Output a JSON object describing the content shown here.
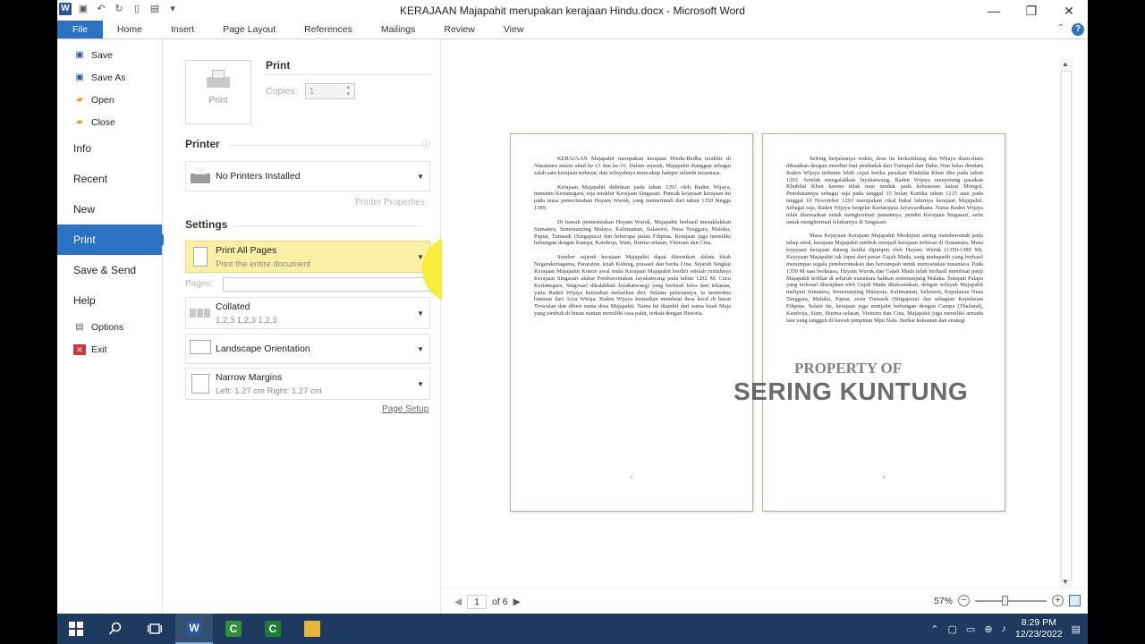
{
  "window": {
    "title": "KERAJAAN Majapahit merupakan kerajaan Hindu.docx - Microsoft Word",
    "minimize": "—",
    "maximize": "❐",
    "close": "✕"
  },
  "ribbon": {
    "tabs": [
      "File",
      "Home",
      "Insert",
      "Page Layout",
      "References",
      "Mailings",
      "Review",
      "View"
    ]
  },
  "backstage": {
    "small_top": [
      "Save",
      "Save As",
      "Open",
      "Close"
    ],
    "items": [
      "Info",
      "Recent",
      "New",
      "Print",
      "Save & Send",
      "Help"
    ],
    "small_bottom": [
      "Options",
      "Exit"
    ],
    "active": "Print"
  },
  "print_panel": {
    "heading": "Print",
    "print_button": "Print",
    "copies_label": "Copies:",
    "copies_value": "1",
    "printer_heading": "Printer",
    "printer_value": "No Printers Installed",
    "printer_properties": "Printer Properties",
    "settings_heading": "Settings",
    "print_range_title": "Print All Pages",
    "print_range_sub": "Print the entire document",
    "pages_label": "Pages:",
    "pages_value": "",
    "collated_title": "Collated",
    "collated_sub": "1,2,3    1,2,3    1,2,3",
    "orientation": "Landscape Orientation",
    "margins_title": "Narrow Margins",
    "margins_sub": "Left:  1.27 cm     Right:  1.27 cm",
    "page_setup": "Page Setup"
  },
  "preview": {
    "page1": [
      "KERAJAAN Majapahit merupakan kerajaan Hindu-Budha terakhir di Nusantara antara abad ke-13 dan ke-16. Dalam sejarah, Majapahit dianggap sebagai salah satu kerajaan terbesar, dan wilayahnya mencakup hampir seluruh nusantara.",
      "Kerajaan Majapahit didirikan pada tahun 1293 oleh Raden Wijaya, menantu Kertanegara, raja terakhir Kerajaan Singasari. Puncak kejayaan kerajaan itu pada masa pemerintahan Hayam Wuruk, yang memerintah dari tahun 1350 hingga 1389.",
      "Di bawah pemerintahan Hayam Wuruk, Majapahit berhasil menaklukkan Sumatera, Semenanjung Malaya, Kalimantan, Sulawesi, Nusa Tenggara, Maluku, Papua, Tumasik (Singapura) dan beberapa pulau Filipina. Kerajaan juga memiliki hubungan dengan Kampa, Kamboja, Siam, Burma selatan, Vietnam dan Cina.",
      "Sumber sejarah kerajaan Majapahit dapat ditemukan dalam kitab Negarakertagama, Pararaton, kitab Kidung, prasasti dan berita Cina. Sejarah Singkat Kerajaan Majapahit Konon awal mula Kerajaan Majapahit berdiri setelah runtuhnya Kerajaan Singasari akibat Pemberontakan Jayakatwang pada tahun 1292 M. Cucu Kertanegara, Singosari dikalahkan Jayakatwang) yang berhasil lolos dari tekanan, yaitu Raden Wijaya kemudian melarikan diri. Selama pelariannya, ia menerima bantuan dari Arya Wiraja. Raden Wijaya kemudian membuat desa kecil di hutan Trowulan dan diberi nama desa Majapahit. Nama ini diambil dari nama buah Maja yang tumbuh di hutan namun memiliki rasa pahit, terkait dengan Historia."
    ],
    "page2": [
      "Seiring berjalannya waktu, desa itu berkembang dan Wijaya diam-diam dikuatkan dengan merebut hati penduduk dari Tumapel dan Daha. Niat balas dendam Raden Wijaya terbantu lebih cepat ketika pasukan Khubilai Khan tiba pada tahun 1293. Setelah mengalahkan Jayakatwang, Raden Wijaya menyerang pasukan Khubilai Khan karena tidak mau tunduk pada kekuasaan kaisar Mongol. Penobatannya sebagai raja pada tanggal 15 bulan Kartika tahun 1215 atau pada tanggal 10 November 1293 merupakan cikal bakal lahirnya kerajaan Majapahit. Sebagai raja, Raden Wijaya bergelar Kertarajasa Jayawardhana. Nama Raden Wijaya telah disematkan untuk menghormati pamannya, pendiri Kerajaan Singasari, serta untuk menghormati leluhurnya di Singasari.",
      "Masa Kejayaan Kerajaan Majapahit Meskipun sering memberontak pada tahap awal, kerajaan Majapahit tumbuh menjadi kerajaan terbesar di Nusantara. Masa kejayaan kerajaan datang ketika dipimpin oleh Hayam Wuruk (1350-1389 M). Kejayaan Majapahit tak luput dari peran Gajah Mada, sang mahapatih yang berhasil menumpas segala pemberontakan dan bersumpah untuk menyatukan nusantara. Pada 1359 M saat berkuasa, Hayam Wuruk dan Gajah Mada telah berhasil membuat panji Majapahit terlihat di seluruh nusantara bahkan semenanjung Malaka. Sumpah Palapa yang terkenal diucapkan oleh Gajah Mada dilaksanakan, dengan wilayah Majapahit meliputi Sumatera, Semenanjung Malaysia, Kalimantan, Sulawesi, Kepulauan Nusa Tenggara, Maluku, Papua, serta Tumasik (Singapura) dan sebagian Kepulauan Filipina. Selain itu, kerajaan juga menjalin hubungan dengan Campa (Thailand), Kamboja, Siam, Burma selatan, Vietnam dan Cina. Majapahit juga memiliki armada laut yang tangguh di bawah pimpinan Mpu Nala. Berkat kekuatan dan strategi"
    ],
    "page1_number": "1",
    "page2_number": "2",
    "watermark_line1": "PROPERTY OF",
    "watermark_line2": "SERING KUNTUNG"
  },
  "footer": {
    "current_page": "1",
    "of_pages": "of 6",
    "zoom": "57%"
  },
  "taskbar": {
    "time": "8:29 PM",
    "date": "12/23/2022"
  }
}
